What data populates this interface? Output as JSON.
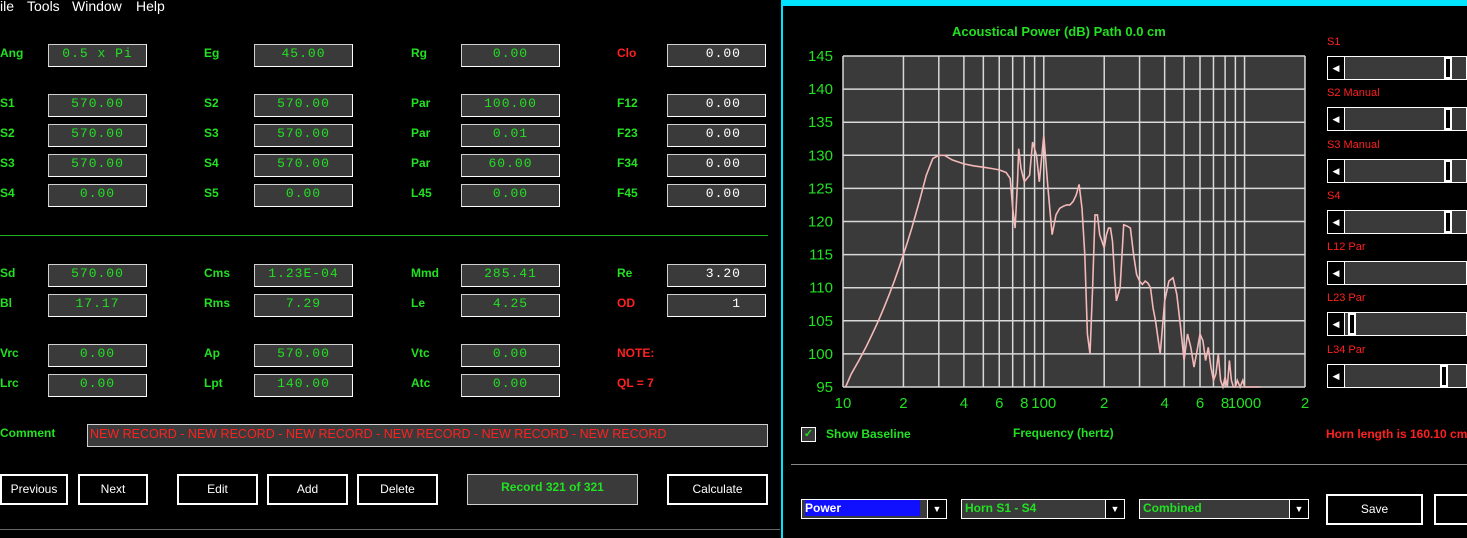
{
  "menu": {
    "file": "ile",
    "tools": "Tools",
    "window": "Window",
    "help": "Help"
  },
  "form": {
    "row1": [
      {
        "label": "Ang",
        "value": "0.5 x Pi"
      },
      {
        "label": "Eg",
        "value": "45.00"
      },
      {
        "label": "Rg",
        "value": "0.00"
      },
      {
        "label": "Clo",
        "value": "0.00"
      }
    ],
    "row2": [
      {
        "label": "S1",
        "value": "570.00"
      },
      {
        "label": "S2",
        "value": "570.00"
      },
      {
        "label": "Par",
        "value": "100.00"
      },
      {
        "label": "F12",
        "value": "0.00"
      }
    ],
    "row3": [
      {
        "label": "S2",
        "value": "570.00"
      },
      {
        "label": "S3",
        "value": "570.00"
      },
      {
        "label": "Par",
        "value": "0.01"
      },
      {
        "label": "F23",
        "value": "0.00"
      }
    ],
    "row4": [
      {
        "label": "S3",
        "value": "570.00"
      },
      {
        "label": "S4",
        "value": "570.00"
      },
      {
        "label": "Par",
        "value": "60.00"
      },
      {
        "label": "F34",
        "value": "0.00"
      }
    ],
    "row5": [
      {
        "label": "S4",
        "value": "0.00"
      },
      {
        "label": "S5",
        "value": "0.00"
      },
      {
        "label": "L45",
        "value": "0.00"
      },
      {
        "label": "F45",
        "value": "0.00"
      }
    ],
    "row6": [
      {
        "label": "Sd",
        "value": "570.00"
      },
      {
        "label": "Cms",
        "value": "1.23E-04"
      },
      {
        "label": "Mmd",
        "value": "285.41"
      },
      {
        "label": "Re",
        "value": "3.20"
      }
    ],
    "row7": [
      {
        "label": "Bl",
        "value": "17.17"
      },
      {
        "label": "Rms",
        "value": "7.29"
      },
      {
        "label": "Le",
        "value": "4.25"
      },
      {
        "label": "OD",
        "value": "1"
      }
    ],
    "row8": [
      {
        "label": "Vrc",
        "value": "0.00"
      },
      {
        "label": "Ap",
        "value": "570.00"
      },
      {
        "label": "Vtc",
        "value": "0.00"
      },
      {
        "label": "NOTE:",
        "value": ""
      }
    ],
    "row9": [
      {
        "label": "Lrc",
        "value": "0.00"
      },
      {
        "label": "Lpt",
        "value": "140.00"
      },
      {
        "label": "Atc",
        "value": "0.00"
      },
      {
        "label": "QL = 7",
        "value": ""
      }
    ],
    "comment_label": "Comment",
    "comment_value": "NEW RECORD - NEW RECORD - NEW RECORD - NEW RECORD - NEW RECORD - NEW RECORD",
    "record_status": "Record 321 of 321"
  },
  "buttons": {
    "previous": "Previous",
    "next": "Next",
    "edit": "Edit",
    "add": "Add",
    "delete": "Delete",
    "calculate": "Calculate",
    "save": "Save"
  },
  "chart_panel": {
    "title": "Acoustical Power (dB)   Path 0.0 cm",
    "show_baseline": "Show Baseline",
    "xlabel": "Frequency (hertz)",
    "horn_length": "Horn length is 160.10 cm",
    "sliders": [
      {
        "label": "S1",
        "level": 0.82
      },
      {
        "label": "S2 Manual",
        "level": 0.82
      },
      {
        "label": "S3 Manual",
        "level": 0.82
      },
      {
        "label": "S4",
        "level": 0.82
      },
      {
        "label": "L12 Par",
        "level": null
      },
      {
        "label": "L23 Par",
        "level": 0.02
      },
      {
        "label": "L34 Par",
        "level": 0.78
      }
    ],
    "dropdowns": {
      "mode": "Power",
      "horn": "Horn S1 - S4",
      "combine": "Combined"
    }
  },
  "colors": {
    "accent_green": "#22e022",
    "alert_red": "#ff2020",
    "curve": "#f4b8b8",
    "chart_bg": "#3a3a3a",
    "titlebar_cyan": "#00e5ff"
  },
  "chart_data": {
    "type": "line",
    "title": "Acoustical Power (dB)   Path 0.0 cm",
    "xlabel": "Frequency (hertz)",
    "ylabel": "",
    "xscale": "log",
    "xlim": [
      10,
      2000
    ],
    "ylim": [
      95,
      145
    ],
    "yticks": [
      95,
      100,
      105,
      110,
      115,
      120,
      125,
      130,
      135,
      140,
      145
    ],
    "xtick_labels": [
      "10",
      "2",
      "4",
      "6",
      "8",
      "100",
      "2",
      "4",
      "6",
      "8",
      "1000",
      "2"
    ],
    "grid": true,
    "series": [
      {
        "x": [
          10.3,
          11,
          12,
          13,
          14,
          15,
          16,
          17,
          18,
          19,
          20,
          21,
          22,
          24,
          26,
          28,
          30,
          32,
          35,
          40,
          45,
          50,
          55,
          60,
          65,
          68,
          70,
          72,
          74,
          75,
          77,
          80,
          85,
          88,
          92,
          95,
          100,
          105,
          110,
          115,
          120,
          125,
          130,
          135,
          140,
          145,
          150,
          155,
          160,
          165,
          170,
          175,
          180,
          185,
          190,
          195,
          200,
          205,
          210,
          215,
          220,
          225,
          230,
          240,
          250,
          260,
          270,
          280,
          290,
          300,
          310,
          320,
          330,
          340,
          350,
          360,
          380,
          400,
          420,
          440,
          460,
          480,
          500,
          520,
          540,
          560,
          580,
          600,
          620,
          640,
          660,
          680,
          700,
          720,
          740,
          760,
          780,
          800,
          820,
          840,
          860,
          880,
          900,
          920,
          950,
          980,
          1000,
          1050,
          1100,
          1200
        ],
        "y": [
          95,
          97,
          99,
          101,
          103,
          105,
          107,
          109,
          111,
          113,
          115,
          117,
          119,
          123,
          127,
          129.5,
          130,
          130,
          129.3,
          128.7,
          128.4,
          128.2,
          128,
          127.8,
          127.4,
          126.5,
          122,
          119,
          126,
          131,
          128,
          126,
          127,
          132,
          130,
          126,
          133,
          125,
          118,
          121,
          122,
          122.3,
          122.5,
          122.5,
          123,
          124,
          125.6,
          122,
          115,
          103,
          100,
          110,
          121,
          121,
          118,
          117,
          116,
          118,
          119,
          119,
          117,
          112,
          108,
          110,
          119.5,
          119.3,
          119,
          115,
          112,
          111,
          110.5,
          111,
          110.7,
          110,
          107,
          105,
          100,
          108,
          111,
          111.5,
          109,
          104,
          99,
          103,
          101,
          98,
          100.5,
          103,
          102,
          99,
          101,
          98,
          96,
          97,
          100,
          96,
          95,
          96.5,
          95,
          99,
          96,
          95,
          95,
          96,
          95,
          96,
          95,
          95,
          95,
          95
        ]
      }
    ]
  }
}
